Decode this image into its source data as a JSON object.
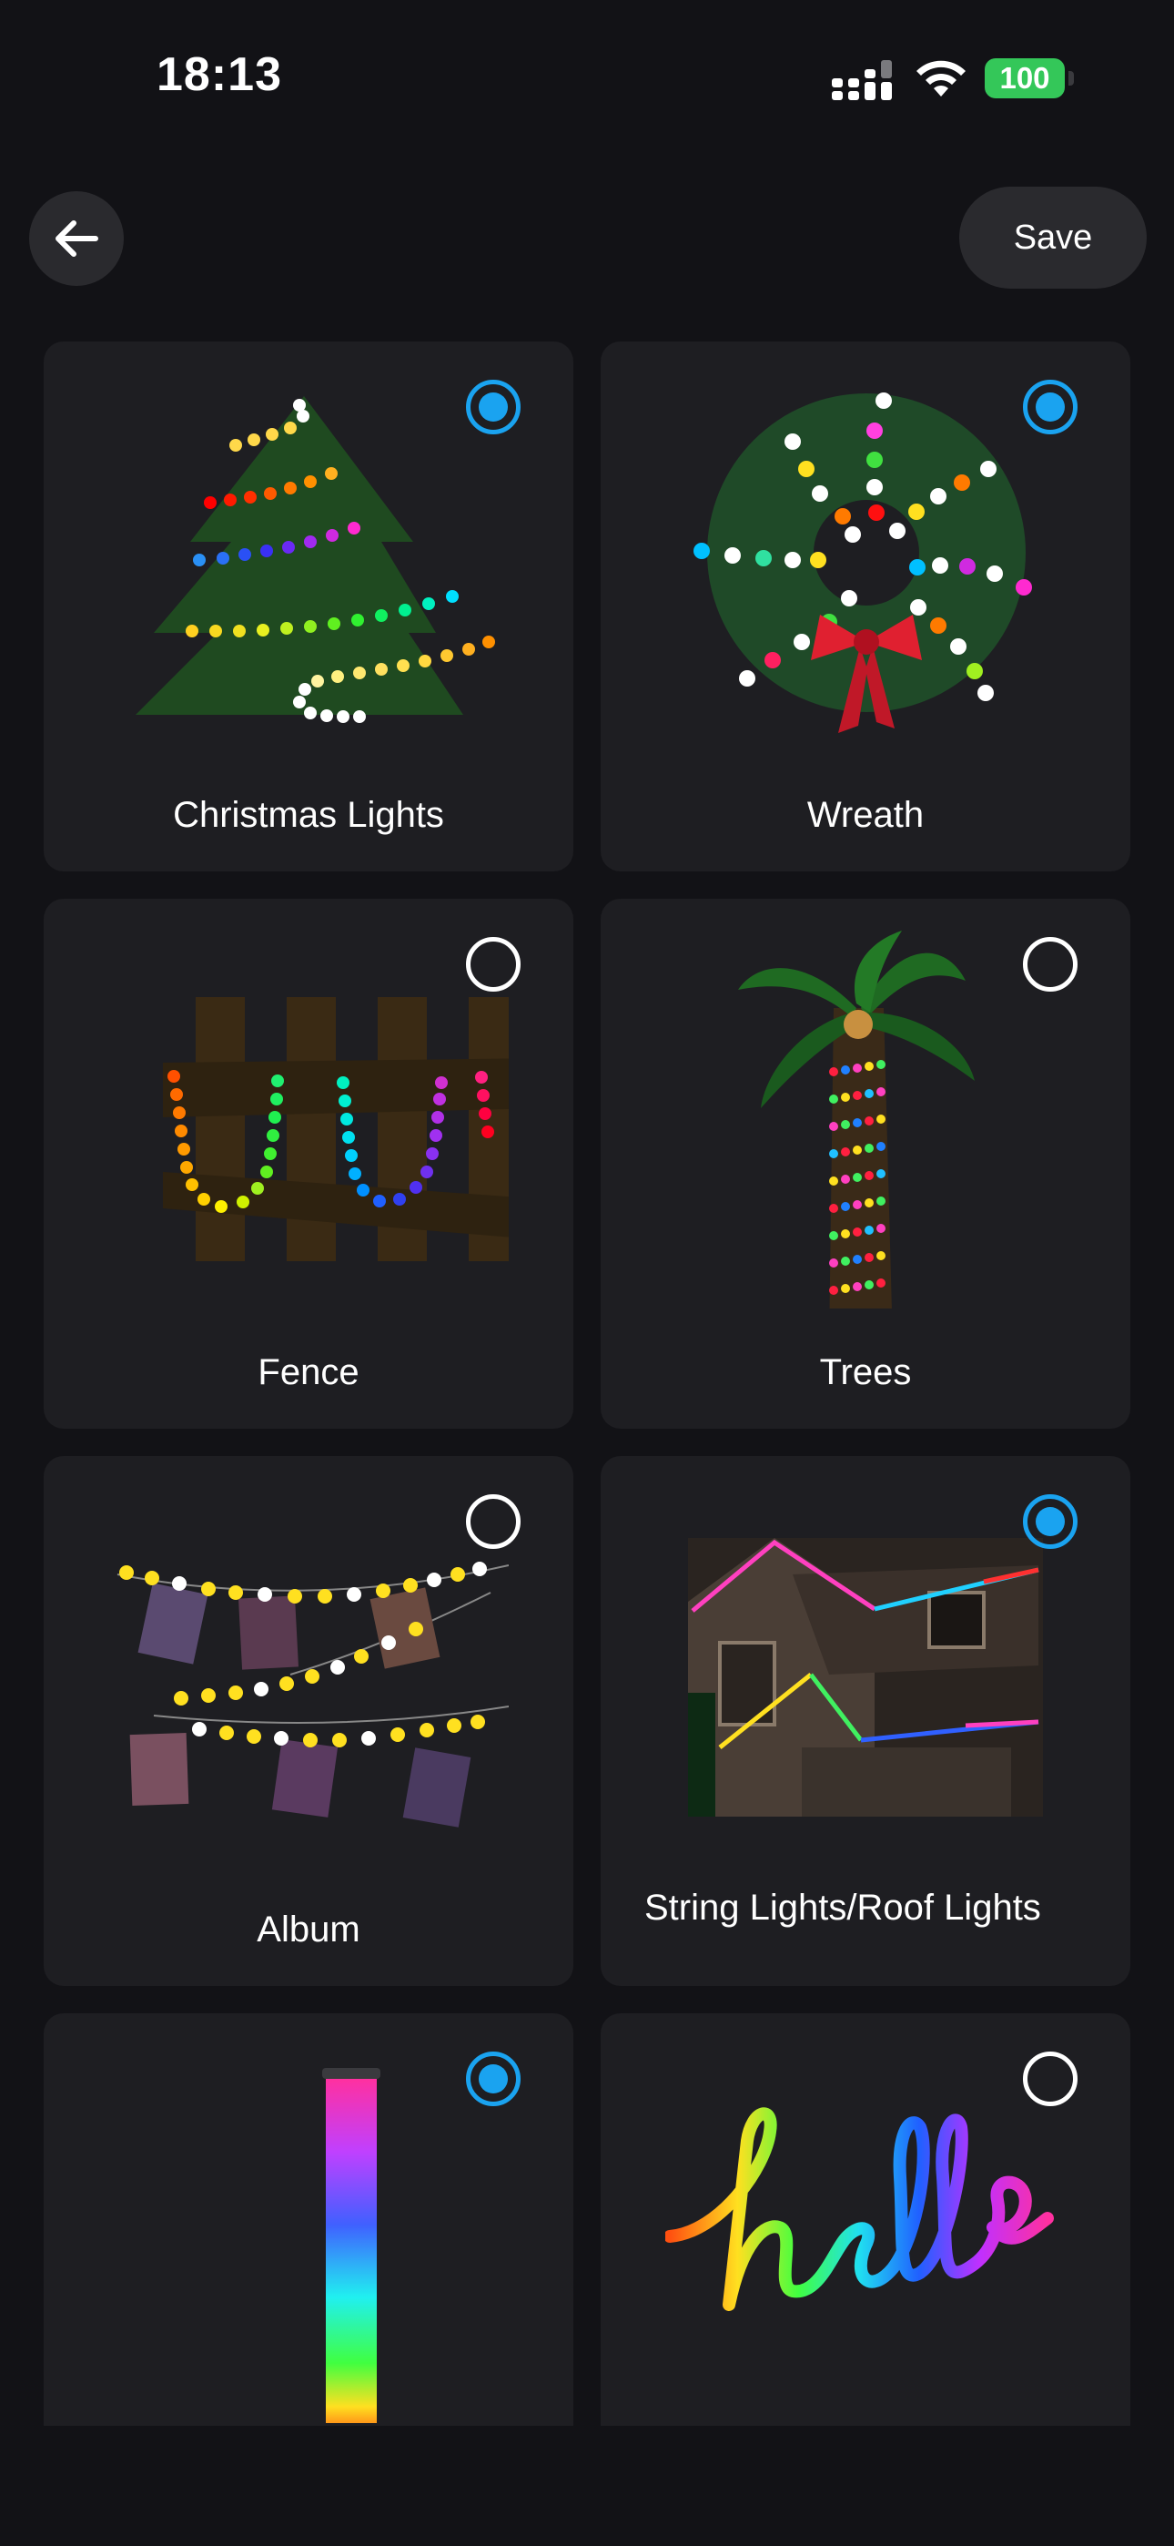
{
  "status_bar": {
    "time": "18:13",
    "battery": "100",
    "icons": [
      "cellular-signal-icon",
      "wifi-icon",
      "battery-icon"
    ]
  },
  "header": {
    "back_icon": "arrow-left-icon",
    "save_label": "Save"
  },
  "scenes": [
    {
      "label": "Christmas Lights",
      "selected": true
    },
    {
      "label": "Wreath",
      "selected": true
    },
    {
      "label": "Fence",
      "selected": false
    },
    {
      "label": "Trees",
      "selected": false
    },
    {
      "label": "Album",
      "selected": false
    },
    {
      "label": "String Lights/Roof Lights",
      "selected": true
    },
    {
      "label": "",
      "selected": true
    },
    {
      "label": "",
      "selected": false
    }
  ],
  "colors": {
    "background": "#121216",
    "card": "#1e1e22",
    "accent": "#1aa3f0",
    "battery": "#34c759"
  }
}
